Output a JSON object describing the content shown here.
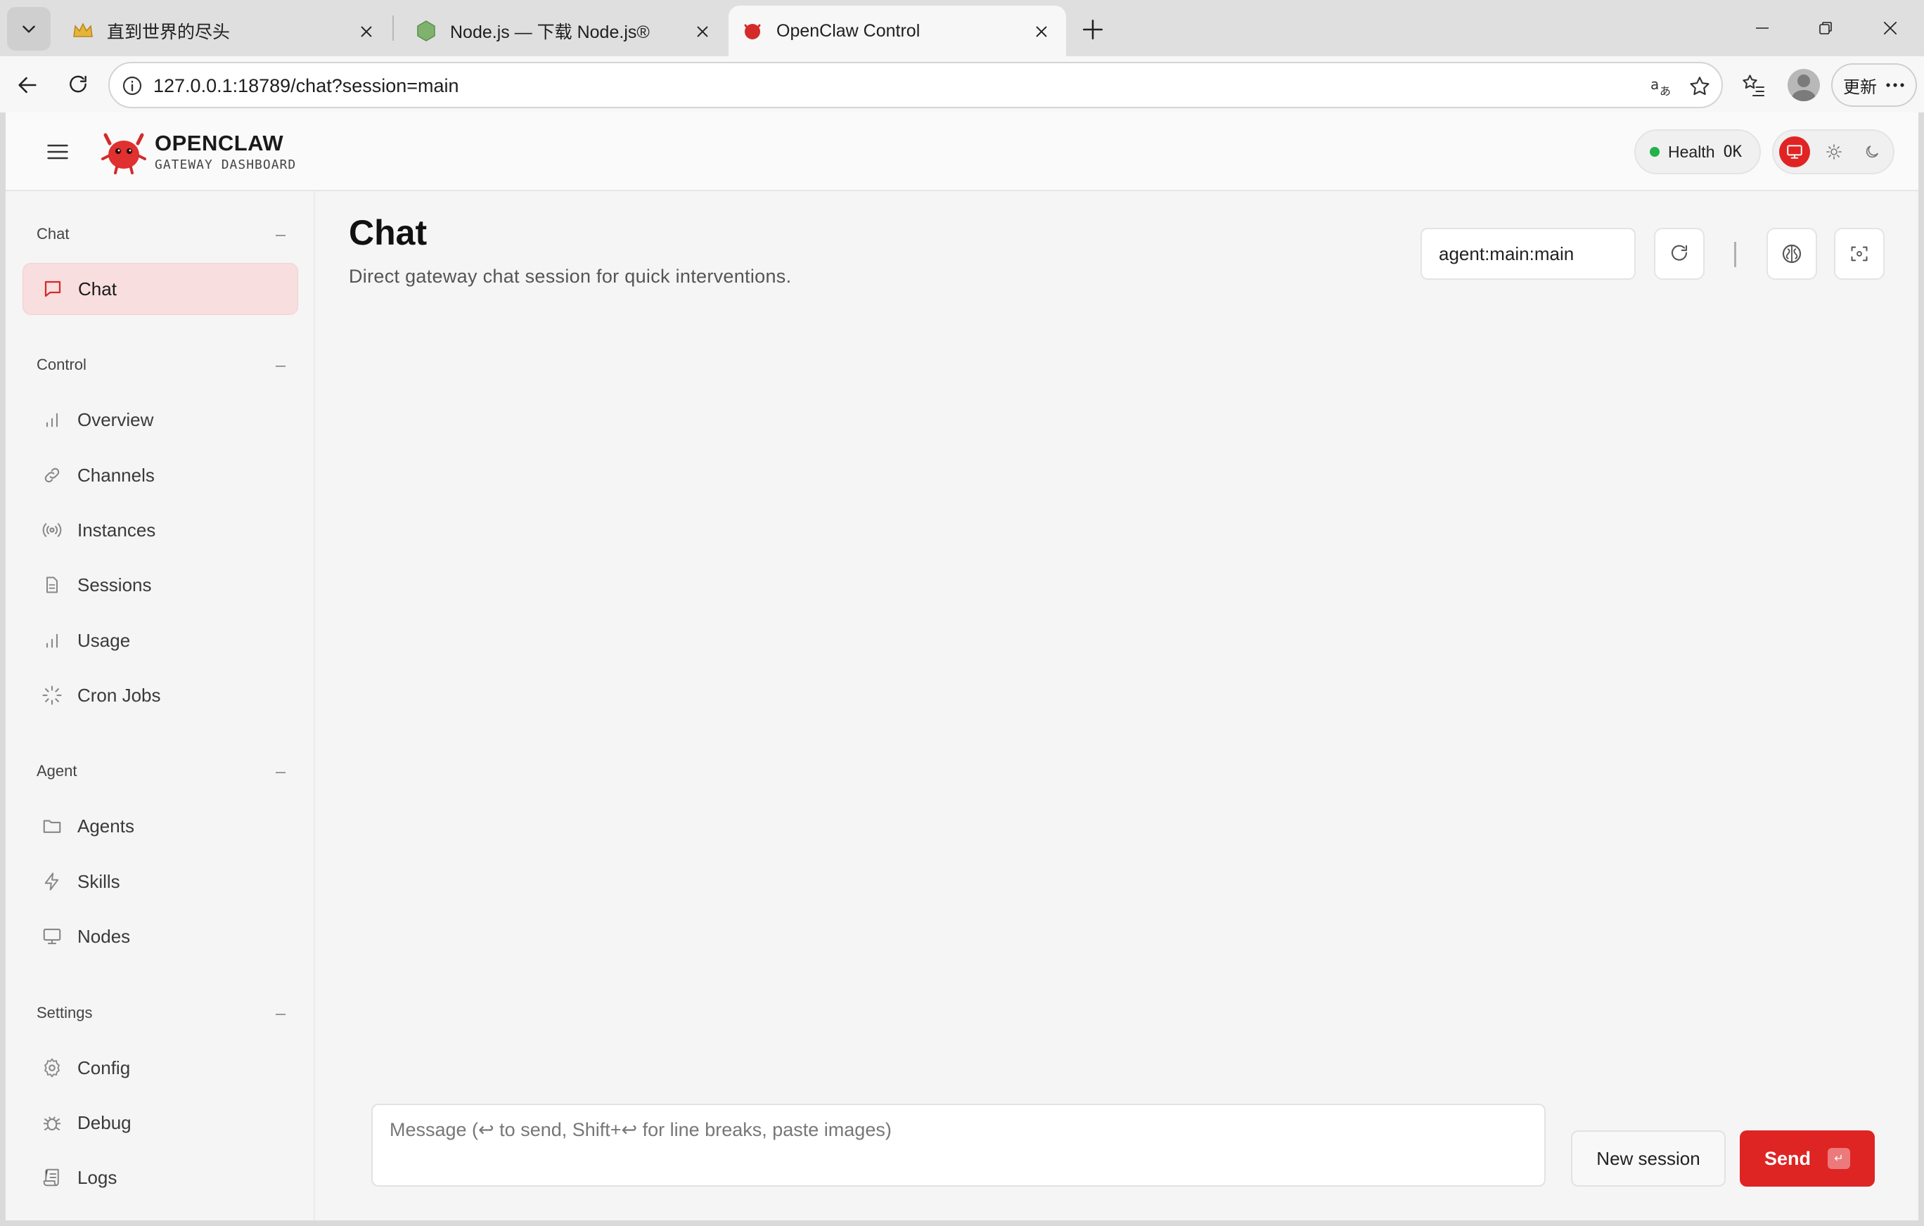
{
  "browser": {
    "tabs": [
      {
        "title": "直到世界的尽头",
        "active": false
      },
      {
        "title": "Node.js — 下载 Node.js®",
        "active": false
      },
      {
        "title": "OpenClaw Control",
        "active": true
      }
    ],
    "url": "127.0.0.1:18789/chat?session=main",
    "update_label": "更新"
  },
  "header": {
    "brand_name": "OPENCLAW",
    "brand_sub": "GATEWAY DASHBOARD",
    "health_label": "Health",
    "health_value": "OK",
    "health_color": "#22b24c"
  },
  "sidebar": {
    "sections": [
      {
        "title": "Chat",
        "items": [
          {
            "label": "Chat",
            "icon": "message-icon",
            "active": true
          }
        ]
      },
      {
        "title": "Control",
        "items": [
          {
            "label": "Overview",
            "icon": "bar-chart-icon"
          },
          {
            "label": "Channels",
            "icon": "link-icon"
          },
          {
            "label": "Instances",
            "icon": "radio-icon"
          },
          {
            "label": "Sessions",
            "icon": "file-icon"
          },
          {
            "label": "Usage",
            "icon": "bar-chart-icon"
          },
          {
            "label": "Cron Jobs",
            "icon": "loader-icon"
          }
        ]
      },
      {
        "title": "Agent",
        "items": [
          {
            "label": "Agents",
            "icon": "folder-icon"
          },
          {
            "label": "Skills",
            "icon": "zap-icon"
          },
          {
            "label": "Nodes",
            "icon": "monitor-icon"
          }
        ]
      },
      {
        "title": "Settings",
        "items": [
          {
            "label": "Config",
            "icon": "settings-icon"
          },
          {
            "label": "Debug",
            "icon": "bug-icon"
          },
          {
            "label": "Logs",
            "icon": "scroll-icon"
          }
        ]
      }
    ]
  },
  "main": {
    "title": "Chat",
    "subtitle": "Direct gateway chat session for quick interventions.",
    "session_value": "agent:main:main",
    "composer_placeholder": "Message (↩ to send, Shift+↩ for line breaks, paste images)",
    "new_session_label": "New session",
    "send_label": "Send",
    "send_kbd": "↵"
  },
  "colors": {
    "accent": "#df2424",
    "active_nav_bg": "#f8dede"
  }
}
